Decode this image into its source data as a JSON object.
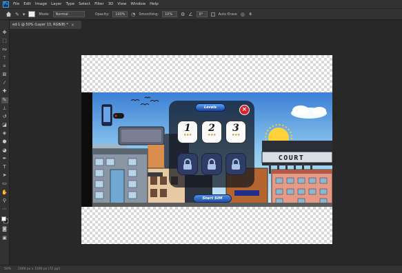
{
  "menu": {
    "logo": "Ps",
    "items": [
      "File",
      "Edit",
      "Image",
      "Layer",
      "Type",
      "Select",
      "Filter",
      "3D",
      "View",
      "Window",
      "Help"
    ]
  },
  "options": {
    "mode_label": "Mode:",
    "mode_value": "Normal",
    "opacity_label": "Opacity:",
    "opacity_value": "100%",
    "smoothing_label": "Smoothing:",
    "smoothing_value": "10%",
    "angle_value": "0°",
    "auto_erase_label": "Auto Erase"
  },
  "document": {
    "tab_label": "ed-1 @ 50% (Layer 13, RGB/8) *",
    "close_glyph": "×"
  },
  "status": {
    "zoom": "50%",
    "info": "1000 px x 1500 px (72 ppi)"
  },
  "game": {
    "levels_title": "Levels",
    "levels": [
      {
        "number": "1",
        "stars": "★★★"
      },
      {
        "number": "2",
        "stars": "★★★"
      },
      {
        "number": "3",
        "stars": "★★★"
      }
    ],
    "locked_count": 3,
    "start_label": "Start SIM",
    "court_sign": "COURT",
    "close_glyph": "×"
  },
  "colors": {
    "sky": "#8cc7ee",
    "panel": "#12161e",
    "lock": "#2f3d66",
    "close": "#d8262c"
  }
}
